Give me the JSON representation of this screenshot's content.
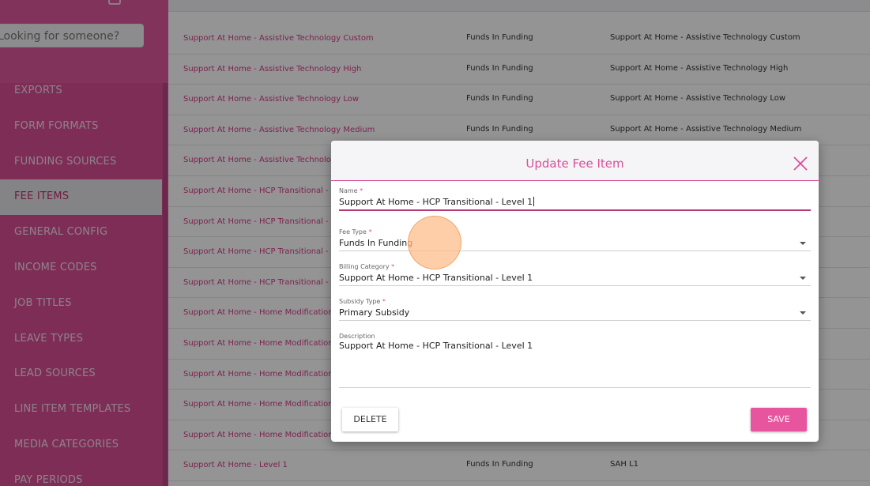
{
  "sidebar": {
    "search_placeholder": "Looking for someone?",
    "items": [
      {
        "label": "EXPORTS"
      },
      {
        "label": "FORM FORMATS"
      },
      {
        "label": "FUNDING SOURCES"
      },
      {
        "label": "FEE ITEMS",
        "active": true
      },
      {
        "label": "GENERAL CONFIG"
      },
      {
        "label": "INCOME CODES"
      },
      {
        "label": "JOB TITLES"
      },
      {
        "label": "LEAVE TYPES"
      },
      {
        "label": "LEAD SOURCES"
      },
      {
        "label": "LINE ITEM TEMPLATES"
      },
      {
        "label": "MEDIA CATEGORIES"
      },
      {
        "label": "PAY PERIODS"
      }
    ]
  },
  "table": {
    "rows": [
      {
        "name": "Support At Home - Assistive Technology Custom",
        "fee_type": "Funds In Funding",
        "billing": "Support At Home - Assistive Technology Custom"
      },
      {
        "name": "Support At Home - Assistive Technology High",
        "fee_type": "Funds In Funding",
        "billing": "Support At Home - Assistive Technology High"
      },
      {
        "name": "Support At Home - Assistive Technology Low",
        "fee_type": "Funds In Funding",
        "billing": "Support At Home - Assistive Technology Low"
      },
      {
        "name": "Support At Home - Assistive Technology Medium",
        "fee_type": "Funds In Funding",
        "billing": "Support At Home - Assistive Technology Medium"
      },
      {
        "name": "Support At Home - Assistive Technolog",
        "fee_type": "",
        "billing": ""
      },
      {
        "name": "Support At Home - HCP Transitional - L",
        "fee_type": "",
        "billing": ""
      },
      {
        "name": "Support At Home - HCP Transitional - L",
        "fee_type": "",
        "billing": ""
      },
      {
        "name": "Support At Home - HCP Transitional - L",
        "fee_type": "",
        "billing": ""
      },
      {
        "name": "Support At Home - HCP Transitional - L",
        "fee_type": "",
        "billing": ""
      },
      {
        "name": "Support At Home - Home Modification",
        "fee_type": "",
        "billing": ""
      },
      {
        "name": "Support At Home - Home Modification",
        "fee_type": "",
        "billing": ""
      },
      {
        "name": "Support At Home - Home Modification",
        "fee_type": "",
        "billing": ""
      },
      {
        "name": "Support At Home - Home Modification",
        "fee_type": "",
        "billing": ""
      },
      {
        "name": "Support At Home - Home Modification",
        "fee_type": "",
        "billing": ""
      },
      {
        "name": "Support At Home - Level 1",
        "fee_type": "Funds In Funding",
        "billing": "SAH L1"
      }
    ]
  },
  "modal": {
    "title": "Update Fee Item",
    "name": {
      "label": "Name",
      "required": "*",
      "value": "Support At Home - HCP Transitional - Level 1"
    },
    "fee_type": {
      "label": "Fee Type",
      "required": "*",
      "value": "Funds In Funding"
    },
    "billing_category": {
      "label": "Billing Category",
      "required": "*",
      "value": "Support At Home - HCP Transitional - Level 1"
    },
    "subsidy_type": {
      "label": "Subsidy Type",
      "required": "*",
      "value": "Primary Subsidy"
    },
    "description": {
      "label": "Description",
      "value": "Support At Home - HCP Transitional - Level 1"
    },
    "delete_label": "DELETE",
    "save_label": "SAVE"
  },
  "colors": {
    "accent": "#d94f97",
    "save": "#e8559f"
  }
}
